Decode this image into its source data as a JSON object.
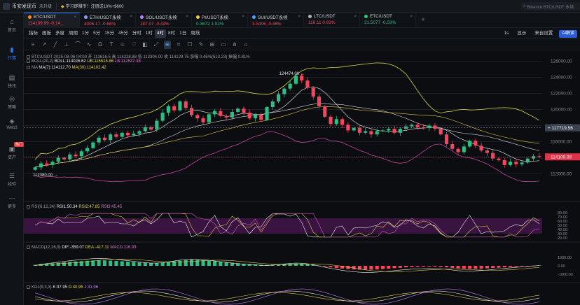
{
  "app": {
    "title": "币安发现币",
    "badge": "未升级",
    "announcement": "学习即赚币！注册送10%+$600",
    "search_placeholder": "Binance BTC/USDT 永续"
  },
  "sidebar": [
    {
      "label": "首页",
      "icon": "home-icon",
      "glyph": "⌂"
    },
    {
      "label": "行情",
      "icon": "chart-icon",
      "glyph": "▮",
      "active": true
    },
    {
      "label": "快讯",
      "icon": "news-icon",
      "glyph": "▤"
    },
    {
      "label": "策略",
      "icon": "strategy-icon",
      "glyph": "◎"
    },
    {
      "label": "Web3",
      "icon": "web3-icon",
      "glyph": "◈"
    },
    {
      "label": "资产",
      "icon": "wallet-icon",
      "glyph": "▣",
      "hot": "热门"
    },
    {
      "label": "经验",
      "icon": "book-icon",
      "glyph": "☰"
    },
    {
      "label": "更多",
      "icon": "more-icon",
      "glyph": "⋯"
    }
  ],
  "tabs": [
    {
      "name": "BTC/USDT",
      "price": "114109.99",
      "change": "-0.14...",
      "dir": "down",
      "dot": "#f7931a",
      "selected": true
    },
    {
      "name": "ETH/USDT永续",
      "price": "4305.17",
      "change": "-0.68%",
      "dir": "down",
      "dot": "#8aa0ff"
    },
    {
      "name": "SOL/USDT永续",
      "price": "187.07",
      "change": "-0.44%",
      "dir": "down",
      "dot": "#c084fc"
    },
    {
      "name": "PI/USDT永续",
      "price": "0.3672",
      "change": "1.92%",
      "dir": "up",
      "dot": "#f2c94c"
    },
    {
      "name": "SUI/USDT永续",
      "price": "3.5406",
      "change": "-0.46%",
      "dir": "down",
      "dot": "#4da3ff"
    },
    {
      "name": "LTC/USDT",
      "price": "116.11",
      "change": "0.03%",
      "dir": "down",
      "dot": "#b0b5bd"
    },
    {
      "name": "ETC/USDT",
      "price": "21.5077",
      "change": "-0.03%",
      "dir": "up",
      "dot": "#34c77b"
    }
  ],
  "toolbar": {
    "items": [
      "指标",
      "画板",
      "多窗",
      "周期",
      "1分",
      "5分",
      "15分",
      "45分",
      "分时",
      "1时",
      "4时",
      "8时",
      "1日",
      "周线"
    ],
    "selected": "4时",
    "right": [
      "1s",
      "显示",
      "来自设置"
    ],
    "ai": "AI解读"
  },
  "drawtools": [
    "≡",
    "↗",
    "╱",
    "⊥",
    "⌒",
    "∿",
    "Ω",
    "T",
    "☺",
    "♡",
    "◧",
    "⤢",
    "⊕",
    "⌗",
    "☐",
    "✎",
    "⊞",
    "▭",
    "⋔",
    "⌂"
  ],
  "legend": {
    "main": "BTC/USDT 2025-08-06 04:00 开 113616.5 高 114228.88 低 113304.00 收 114129.75 涨幅 0.45%(513.23) 振幅 0.81%",
    "boll": {
      "prefix": "BOLL(20,2)",
      "mid": "BOLL:114026.62",
      "ub": "UB:115515.86",
      "lb": "LB:112537.38"
    },
    "ma": {
      "prefix": "MA",
      "ma7": "MA(7):114112.70",
      "ma30": "MA(30):114102.42"
    },
    "rsi": {
      "prefix": "RSI(6,12,24)",
      "r1": "RSI1:50.34",
      "r2": "RSI2:47.85",
      "r3": "RSI3:45.45"
    },
    "macd": {
      "prefix": "MACD(12,26,9)",
      "dif": "DIF:-359.07",
      "dea": "DEA:-417.11",
      "macd": "MACD:116.09"
    },
    "kdj": {
      "prefix": "KDJ(9,3,3)",
      "k": "K:37.95",
      "d": "D:40.95",
      "j": "J:31.96"
    }
  },
  "chart_data": {
    "type": "candlestick",
    "ylim": [
      111000,
      127000
    ],
    "yticks": [
      112000,
      114000,
      116000,
      118000,
      120000,
      122000,
      124000,
      126000
    ],
    "high_label": "124474.00",
    "low_label": "112380.00",
    "crosshair_price": "117719.56",
    "last_price": "114109.99",
    "closes": [
      112800,
      113300,
      113100,
      113500,
      114000,
      113800,
      114400,
      114200,
      114800,
      115200,
      115900,
      116500,
      116200,
      116900,
      116600,
      117100,
      116800,
      117000,
      117300,
      117800,
      117500,
      118600,
      119600,
      120400,
      119900,
      121000,
      120200,
      119300,
      118900,
      118400,
      119400,
      119800,
      119200,
      119000,
      119700,
      120100,
      119600,
      118900,
      119300,
      118700,
      120300,
      121000,
      121900,
      122600,
      123200,
      124200,
      123600,
      122700,
      121600,
      120400,
      119100,
      118200,
      118800,
      118100,
      117400,
      117700,
      117100,
      117300,
      116900,
      117300,
      117400,
      117600,
      117100,
      117600,
      117900,
      118100,
      117800,
      117700,
      118000,
      117600,
      116900,
      115700,
      115100,
      114700,
      115400,
      116100,
      115500,
      114900,
      114600,
      113900,
      113700,
      113100,
      113500,
      113200,
      113400,
      113900,
      114200,
      114109
    ],
    "rsi_yticks": [
      20,
      30,
      40,
      50,
      60,
      70,
      80
    ],
    "macd_yticks": [
      1000,
      0,
      -1000
    ],
    "macd_hist": [
      120,
      200,
      260,
      310,
      360,
      420,
      470,
      520,
      560,
      600,
      640,
      660,
      650,
      620,
      580,
      540,
      500,
      450,
      400,
      360,
      330,
      340,
      380,
      460,
      540,
      620,
      680,
      720,
      700,
      660,
      610,
      550,
      480,
      420,
      360,
      300,
      250,
      200,
      160,
      120,
      90,
      120,
      160,
      200,
      240,
      270,
      250,
      200,
      120,
      20,
      -80,
      -180,
      -260,
      -330,
      -390,
      -430,
      -460,
      -470,
      -460,
      -430,
      -390,
      -340,
      -280,
      -230,
      -180,
      -140,
      -120,
      -100,
      -90,
      -100,
      -130,
      -180,
      -240,
      -300,
      -340,
      -360,
      -350,
      -330,
      -300,
      -260,
      -220,
      -180,
      -140,
      -100,
      -60,
      -20,
      20,
      60
    ]
  }
}
